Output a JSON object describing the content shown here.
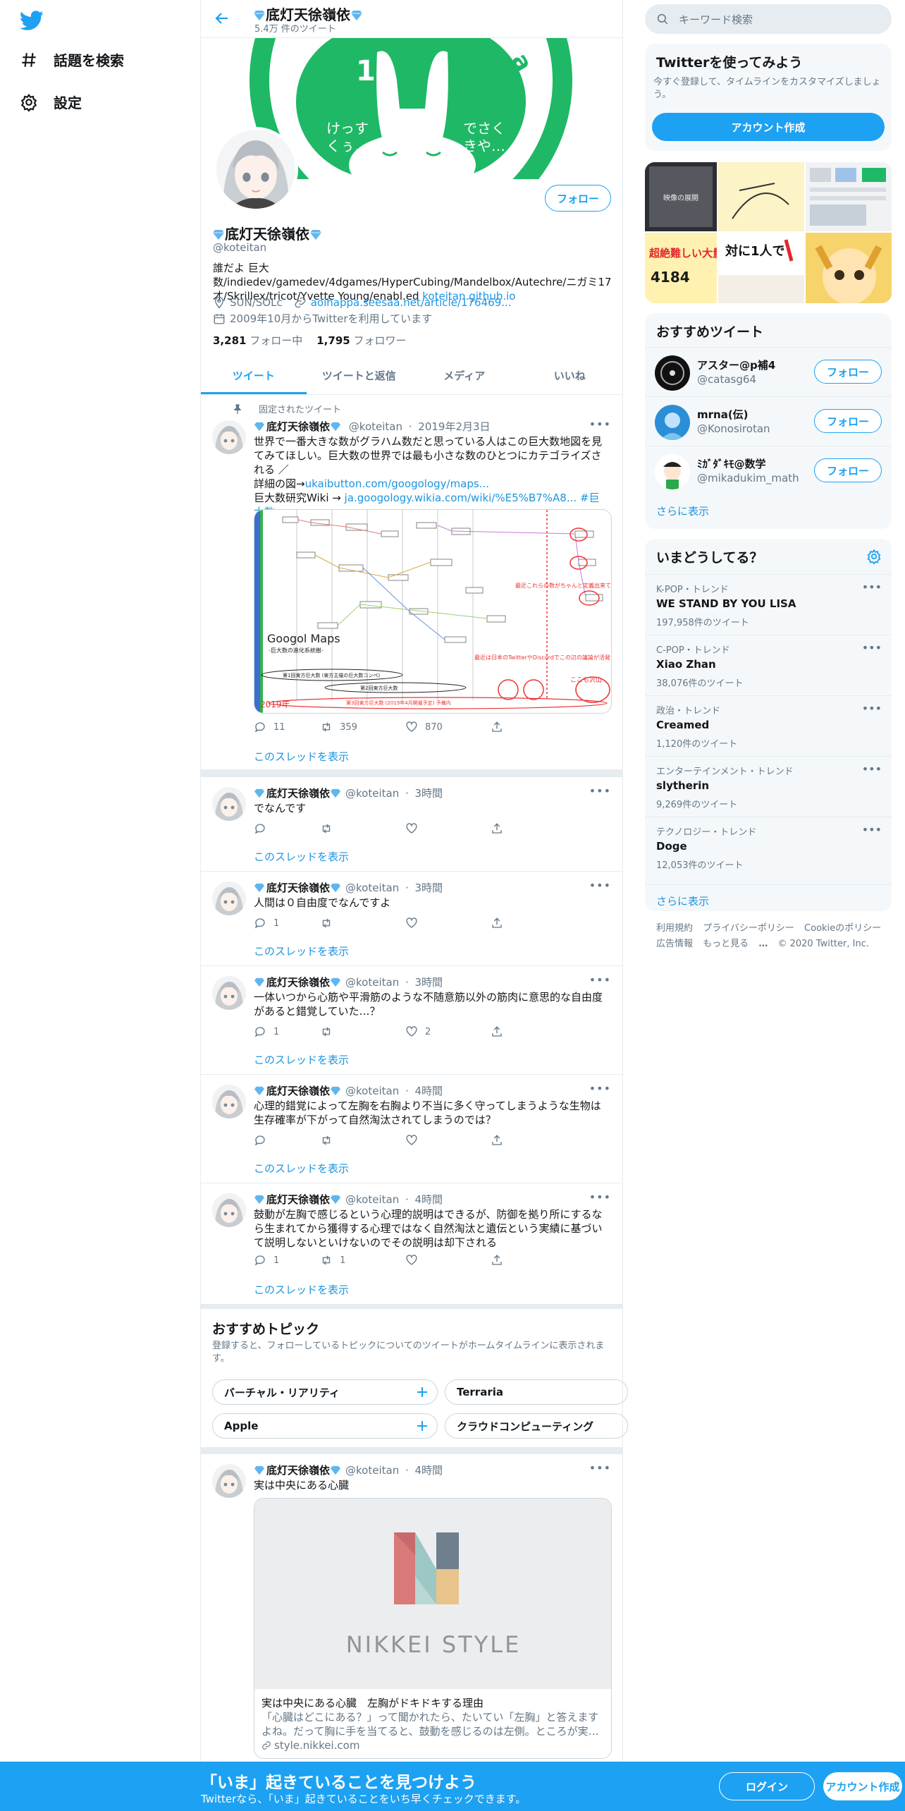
{
  "nav": {
    "explore": "話題を検索",
    "settings": "設定"
  },
  "profile": {
    "name": "底灯天徐嶺依",
    "tweet_count": "5.4万 件のツイート",
    "handle": "@koteitan",
    "follow_label": "フォロー",
    "bio_text": "誰だよ 巨大数/indiedev/gamedev/4dgames/HyperCubing/Mandelbox/Autechre/ニガミ17才/Skrillex/tricot/Yvette Young/enabl.ed ",
    "bio_link": "koteitan.github.io",
    "location": "SUN/SOLc",
    "website": "aoihappa.seesaa.net/article/176469...",
    "joined": "2009年10月からTwitterを利用しています",
    "following_count": "3,281",
    "following_label": "フォロー中",
    "followers_count": "1,795",
    "followers_label": "フォロワー",
    "banner_text_left": "けっす\nくぅ…",
    "banner_text_right": "でさく\nきや…",
    "banner_letter": "a"
  },
  "tabs": [
    "ツイート",
    "ツイートと返信",
    "メディア",
    "いいね"
  ],
  "pinned_label": "固定されたツイート",
  "show_thread": "このスレッドを表示",
  "tweets": [
    {
      "name": "底灯天徐嶺依",
      "handle": "@koteitan",
      "time": "2019年2月3日",
      "text": "世界で一番大きな数がグラハム数だと思っている人はこの巨大数地図を見てみてほしい。巨大数の世界では最も小さな数のひとつにカテゴライズされる ／\n詳細の図→",
      "link1": "ukaibutton.com/googology/maps...",
      "text2": "巨大数研究Wiki → ",
      "link2": "ja.googology.wikia.com/wiki/%E5%B7%A8...",
      "hashtag": "#巨大数",
      "replies": "11",
      "retweets": "359",
      "likes": "870",
      "map_title": "Googol Maps",
      "map_subtitle": "-巨大数の進化系統樹-",
      "map_year": "2019年",
      "map_label_1": "最近これらの数がちゃんと定義出来ているか疑われている",
      "map_label_2": "最近は日本のTwitterやDiscordでこの辺の議論が活発",
      "map_label_3": "ここも沢山",
      "map_bottom": "第3回東方巨大数 (2019年4月開催予定) 予備内",
      "map_row_1": "第1回東方巨大数\n(東方主催の巨大数コンペ)",
      "map_row_2": "第2回東方巨大数"
    },
    {
      "name": "底灯天徐嶺依",
      "handle": "@koteitan",
      "time": "3時間",
      "text": "でなんです",
      "replies": "",
      "retweets": "",
      "likes": ""
    },
    {
      "name": "底灯天徐嶺依",
      "handle": "@koteitan",
      "time": "3時間",
      "text": "人間は０自由度でなんですよ",
      "replies": "1",
      "retweets": "",
      "likes": ""
    },
    {
      "name": "底灯天徐嶺依",
      "handle": "@koteitan",
      "time": "3時間",
      "text": "一体いつから心筋や平滑筋のような不随意筋以外の筋肉に意思的な自由度があると錯覚していた…？",
      "replies": "1",
      "retweets": "",
      "likes": "2"
    },
    {
      "name": "底灯天徐嶺依",
      "handle": "@koteitan",
      "time": "4時間",
      "text": "心理的錯覚によって左胸を右胸より不当に多く守ってしまうような生物は生存確率が下がって自然淘汰されてしまうのでは？",
      "replies": "",
      "retweets": "",
      "likes": ""
    },
    {
      "name": "底灯天徐嶺依",
      "handle": "@koteitan",
      "time": "4時間",
      "text": "鼓動が左胸で感じるという心理的説明はできるが、防御を拠り所にするなら生まれてから獲得する心理ではなく自然淘汰と遺伝という実績に基づいて説明しないといけないのでその説明は却下される",
      "replies": "1",
      "retweets": "1",
      "likes": ""
    },
    {
      "name": "底灯天徐嶺依",
      "handle": "@koteitan",
      "time": "4時間",
      "text": "実は中央にある心臓"
    }
  ],
  "topics": {
    "title": "おすすめトピック",
    "subtitle": "登録すると、フォローしているトピックについてのツイートがホームタイムラインに表示されます。",
    "chips": [
      "バーチャル・リアリティ",
      "Terraria",
      "Apple",
      "クラウドコンピューティング"
    ]
  },
  "card": {
    "brand": "NIKKEI STYLE",
    "title": "実は中央にある心臓　左胸がドキドキする理由",
    "desc": "「心臓はどこにある？」って聞かれたら、たいてい「左胸」と答えますよね。だって胸に手を当てると、鼓動を感じるのは左側。ところが実…",
    "domain": "style.nikkei.com"
  },
  "sidebar": {
    "search_placeholder": "キーワード検索",
    "signup_title": "Twitterを使ってみよう",
    "signup_sub": "今すぐ登録して、タイムラインをカスタマイズしましょう。",
    "signup_button": "アカウント作成",
    "media_text_1": "映像の展開",
    "media_text_2": "超絶難しい大量",
    "media_text_3": "4184",
    "media_text_4": "対に1人で",
    "rec_title": "おすすめツイート",
    "rec_users": [
      {
        "name": "アスター@p補4",
        "handle": "@catasg64",
        "follow": "フォロー"
      },
      {
        "name": "mrna(伝)",
        "handle": "@Konosirotan",
        "follow": "フォロー"
      },
      {
        "name": "ﾐｶﾞﾀﾞｷﾓ@数学",
        "handle": "@mikadukim_math",
        "follow": "フォロー"
      }
    ],
    "show_more": "さらに表示",
    "trends_title": "いまどうしてる？",
    "trends": [
      {
        "cat": "K-POP・トレンド",
        "name": "WE STAND BY YOU LISA",
        "count": "197,958件のツイート"
      },
      {
        "cat": "C-POP・トレンド",
        "name": "Xiao Zhan",
        "count": "38,076件のツイート"
      },
      {
        "cat": "政治・トレンド",
        "name": "Creamed",
        "count": "1,120件のツイート"
      },
      {
        "cat": "エンターテインメント・トレンド",
        "name": "slytherin",
        "count": "9,269件のツイート"
      },
      {
        "cat": "テクノロジー・トレンド",
        "name": "Doge",
        "count": "12,053件のツイート"
      }
    ],
    "footer": [
      "利用規約",
      "プライバシーポリシー",
      "Cookieのポリシー",
      "広告情報",
      "もっと見る",
      "© 2020 Twitter, Inc."
    ]
  },
  "bottombar": {
    "title": "「いま」起きていることを見つけよう",
    "subtitle": "Twitterなら、「いま」起きていることをいち早くチェックできます。",
    "login": "ログイン",
    "signup": "アカウント作成"
  },
  "colors": {
    "accent": "#1da1f2",
    "link": "#1b95e0",
    "banner_green": "#1fb866",
    "bottom_bar": "#1da1f2"
  }
}
